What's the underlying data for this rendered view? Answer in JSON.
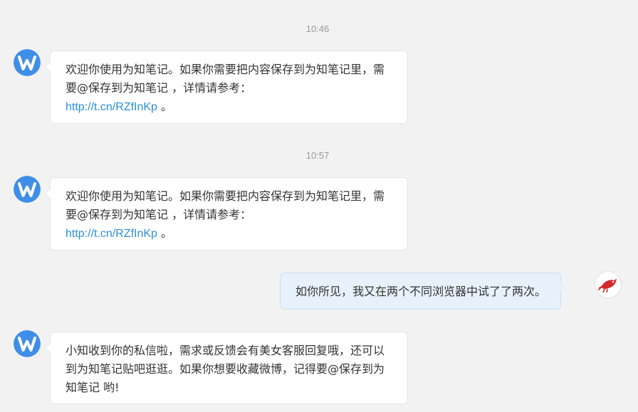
{
  "conversation": {
    "messages": [
      {
        "time": "10:46",
        "sender": "weibo-notes-bot",
        "text_before": "欢迎你使用为知笔记。如果你需要把内容保存到为知笔记里，需要@保存到为知笔记 ，详情请参考：",
        "link": "http://t.cn/RZfInKp",
        "text_after": " 。"
      },
      {
        "time": "10:57",
        "sender": "weibo-notes-bot",
        "text_before": "欢迎你使用为知笔记。如果你需要把内容保存到为知笔记里，需要@保存到为知笔记 ，详情请参考：",
        "link": "http://t.cn/RZfInKp",
        "text_after": " 。"
      },
      {
        "sender": "me",
        "text": "如你所见，我又在两个不同浏览器中试了了两次。"
      },
      {
        "sender": "weibo-notes-bot",
        "text": "小知收到你的私信啦，需求或反馈会有美女客服回复哦，还可以到为知笔记贴吧逛逛。如果你想要收藏微博，记得要@保存到为知笔记 哟!"
      }
    ]
  },
  "colors": {
    "background": "#f2f2f2",
    "bot_bubble": "#ffffff",
    "my_bubble": "#e6f1fb",
    "link": "#2b8fd6",
    "bot_avatar": "#3f8ee8"
  },
  "icons": {
    "bot_avatar": "wiz-w-logo-icon",
    "my_avatar": "red-bird-icon"
  }
}
